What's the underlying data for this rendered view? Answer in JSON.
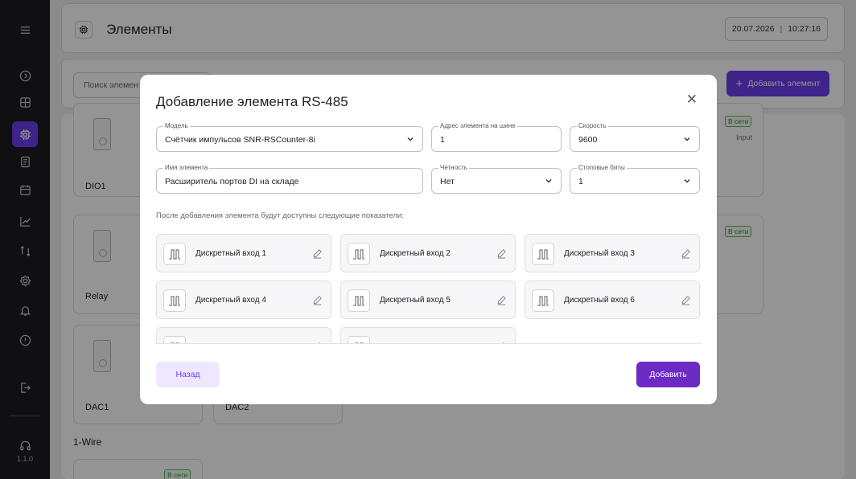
{
  "sidebar": {
    "items": [
      {
        "icon": "menu-icon"
      },
      {
        "icon": "arrow-circle-icon"
      },
      {
        "icon": "dashboard-icon"
      },
      {
        "icon": "chip-icon"
      },
      {
        "icon": "document-icon"
      },
      {
        "icon": "calendar-icon"
      },
      {
        "icon": "chart-icon"
      },
      {
        "icon": "sync-icon"
      },
      {
        "icon": "settings-icon"
      },
      {
        "icon": "bell-icon"
      },
      {
        "icon": "info-icon"
      },
      {
        "icon": "logout-icon"
      },
      {
        "icon": "headset-icon"
      }
    ],
    "active_item": "chip-icon",
    "accent_color": "#6b3df0",
    "version": "1.1.0"
  },
  "header": {
    "title": "Элементы",
    "date": "20.07.2026",
    "separator": "|",
    "time": "10:27:16"
  },
  "toolbar": {
    "search_placeholder": "Поиск элемент",
    "add_button_label": "Добавить элемент"
  },
  "background": {
    "cards": [
      {
        "name": "DIO1"
      },
      {
        "name": "Relay"
      },
      {
        "name": "DAC1"
      },
      {
        "name": "DAC2"
      }
    ],
    "status_badges": [
      "В сети",
      "В сети",
      "В сети"
    ],
    "type_label": "Input",
    "section_title": "1-Wire"
  },
  "modal": {
    "title": "Добавление элемента RS-485",
    "fields": {
      "model": {
        "label": "Модель",
        "value": "Счётчик импульсов SNR-RSCounter-8i"
      },
      "address": {
        "label": "Адрес элемента на шине",
        "value": "1"
      },
      "speed": {
        "label": "Скорость",
        "value": "9600"
      },
      "name": {
        "label": "Имя элемента",
        "value": "Расширитель портов DI на складе"
      },
      "parity": {
        "label": "Четность",
        "value": "Нет"
      },
      "stop_bits": {
        "label": "Стоповые биты",
        "value": "1"
      }
    },
    "info_text": "После добавления элемента будут доступны следующие показатели:",
    "indicators": [
      "Дискретный вход 1",
      "Дискретный вход 2",
      "Дискретный вход 3",
      "Дискретный вход 4",
      "Дискретный вход 5",
      "Дискретный вход 6",
      "",
      ""
    ],
    "back_label": "Назад",
    "submit_label": "Добавить",
    "submit_color": "#6b2bc4"
  }
}
